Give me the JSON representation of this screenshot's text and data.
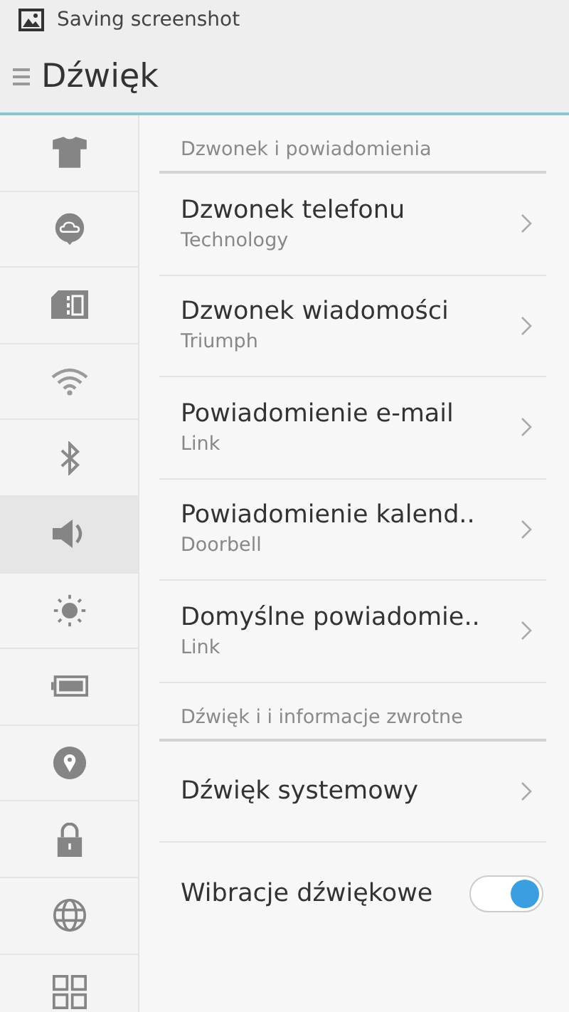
{
  "status_bar": {
    "notification": "Saving screenshot"
  },
  "title_bar": {
    "title": "Dźwięk"
  },
  "sidebar": {
    "items": [
      {
        "kind": "shirt",
        "selected": false
      },
      {
        "kind": "cloud",
        "selected": false
      },
      {
        "kind": "sim",
        "selected": false
      },
      {
        "kind": "wifi",
        "selected": false
      },
      {
        "kind": "bluetooth",
        "selected": false
      },
      {
        "kind": "speaker",
        "selected": true
      },
      {
        "kind": "sun",
        "selected": false
      },
      {
        "kind": "battery",
        "selected": false
      },
      {
        "kind": "pin",
        "selected": false
      },
      {
        "kind": "lock",
        "selected": false
      },
      {
        "kind": "globe",
        "selected": false
      },
      {
        "kind": "grid",
        "selected": false
      }
    ]
  },
  "sections": [
    {
      "header": "Dzwonek i powiadomienia",
      "rows": [
        {
          "kind": "link",
          "title": "Dzwonek telefonu",
          "subtitle": "Technology"
        },
        {
          "kind": "link",
          "title": "Dzwonek wiadomości",
          "subtitle": "Triumph"
        },
        {
          "kind": "link",
          "title": "Powiadomienie e-mail",
          "subtitle": "Link"
        },
        {
          "kind": "link",
          "title": "Powiadomienie kalend..",
          "subtitle": "Doorbell"
        },
        {
          "kind": "link",
          "title": "Domyślne powiadomie..",
          "subtitle": "Link"
        }
      ]
    },
    {
      "header": "Dźwięk i i informacje zwrotne",
      "rows": [
        {
          "kind": "link",
          "title": "Dźwięk systemowy"
        },
        {
          "kind": "toggle",
          "title": "Wibracje dźwiękowe",
          "on": true
        }
      ]
    }
  ]
}
